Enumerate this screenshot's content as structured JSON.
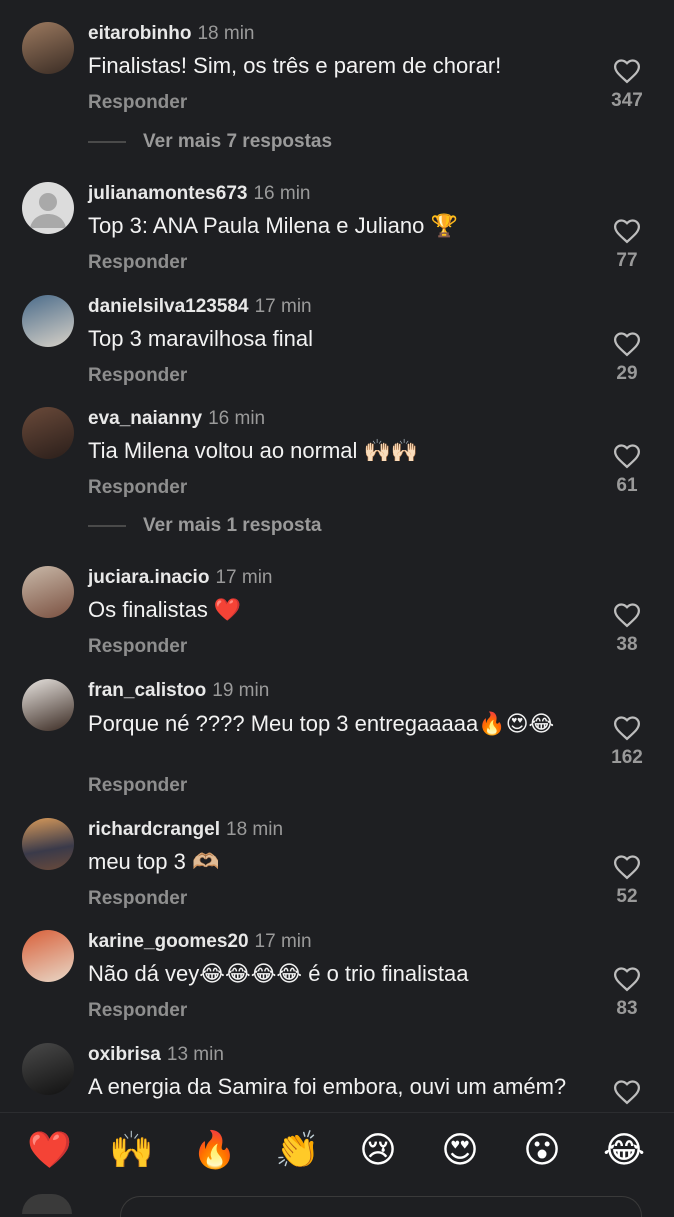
{
  "comments": [
    {
      "user": "eitarobinho",
      "time": "18 min",
      "text": "Finalistas! Sim, os três e parem de chorar!",
      "likes": "347",
      "reply": "Responder"
    },
    {
      "user": "julianamontes673",
      "time": "16 min",
      "text": "Top 3: ANA Paula Milena e Juliano 🏆",
      "likes": "77",
      "reply": "Responder"
    },
    {
      "user": "danielsilva123584",
      "time": "17 min",
      "text": "Top 3 maravilhosa  final",
      "likes": "29",
      "reply": "Responder"
    },
    {
      "user": "eva_naianny",
      "time": "16 min",
      "text": "Tia Milena voltou ao normal 🙌🏻🙌🏻",
      "likes": "61",
      "reply": "Responder"
    },
    {
      "user": "juciara.inacio",
      "time": "17 min",
      "text": "Os finalistas ❤️",
      "likes": "38",
      "reply": "Responder"
    },
    {
      "user": "fran_calistoo",
      "time": "19 min",
      "text": "Porque né ???? Meu top 3 entregaaaaa🔥😍😂",
      "likes": "162",
      "reply": "Responder"
    },
    {
      "user": "richardcrangel",
      "time": "18 min",
      "text": "meu top 3 🫶🏼",
      "likes": "52",
      "reply": "Responder"
    },
    {
      "user": "karine_goomes20",
      "time": "17 min",
      "text": "Não dá vey😂😂😂😂 é o trio finalistaa",
      "likes": "83",
      "reply": "Responder"
    },
    {
      "user": "oxibrisa",
      "time": "13 min",
      "text": "A energia da Samira foi embora, ouvi um amém?",
      "likes": "",
      "reply": ""
    }
  ],
  "more_replies": [
    "Ver mais 7 respostas",
    "Ver mais 1 resposta"
  ],
  "emoji_bar": [
    "❤️",
    "🙌",
    "🔥",
    "👏",
    "😢",
    "😍",
    "😮",
    "😂"
  ],
  "colors": {
    "background": "#1e1f22",
    "username": "#e8e8e8",
    "muted": "#9a9a9a"
  },
  "icons": {
    "like": "heart-outline-icon",
    "avatar_placeholder": "person-silhouette-icon"
  }
}
